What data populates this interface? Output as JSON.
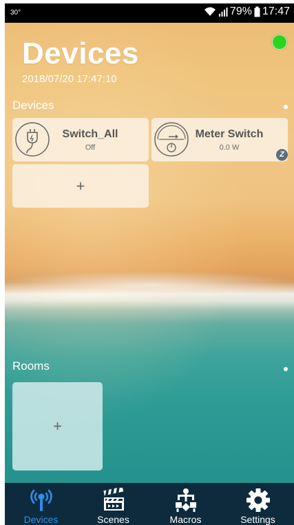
{
  "status_bar": {
    "temperature": "30°",
    "battery_percent": "79%",
    "time": "17:47",
    "icons": [
      "wifi-icon",
      "signal-icon",
      "battery-icon"
    ]
  },
  "header": {
    "title": "Devices",
    "datetime": "2018/07/20 17:47:10",
    "connection_status_color": "#2bd51f"
  },
  "devices_section": {
    "title": "Devices",
    "devices": [
      {
        "name": "Switch_All",
        "status": "Off",
        "icon": "plug-icon"
      },
      {
        "name": "Meter Switch",
        "status": "0.0 W",
        "icon": "meter-icon",
        "badge": "Z",
        "badge_icon": "zwave-icon"
      }
    ],
    "add_label": "+"
  },
  "rooms_section": {
    "title": "Rooms",
    "add_label": "+"
  },
  "bottom_nav": {
    "items": [
      {
        "label": "Devices",
        "icon": "devices-icon",
        "active": true
      },
      {
        "label": "Scenes",
        "icon": "clapperboard-icon",
        "active": false
      },
      {
        "label": "Macros",
        "icon": "macros-icon",
        "active": false
      },
      {
        "label": "Settings",
        "icon": "gear-icon",
        "active": false
      }
    ]
  },
  "colors": {
    "nav_background": "#0d2b3d",
    "nav_active": "#2f8fe8",
    "card_background": "#faeedc"
  }
}
